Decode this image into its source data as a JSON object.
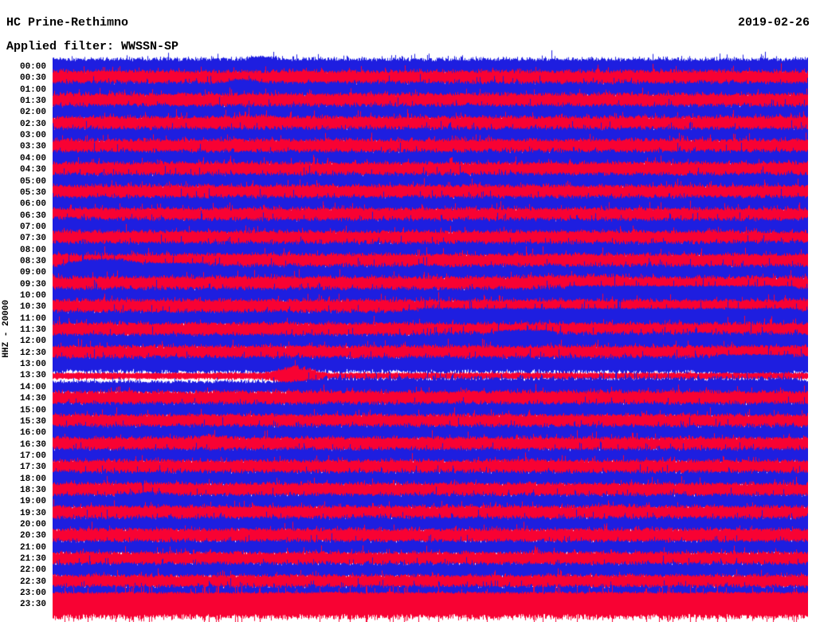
{
  "header": {
    "station_title": "HC Prine-Rethimno",
    "filter_label": "Applied filter: WWSSN-SP",
    "date": "2019-02-26"
  },
  "y_axis": {
    "scale_label": "HHZ - 20000"
  },
  "colors": {
    "red": "#f80233",
    "blue": "#1e1ee0",
    "text": "#000000",
    "background": "#ffffff"
  },
  "chart_data": {
    "type": "helicorder",
    "title": "HC Prine-Rethimno",
    "subtitle": "Applied filter: WWSSN-SP",
    "date": "2019-02-26",
    "channel_scale": "HHZ - 20000",
    "row_interval_minutes": 30,
    "rows_start": "00:00",
    "rows_end": "23:30",
    "legend": "alternating red/blue half-hour traces",
    "rows": [
      {
        "time": "00:00",
        "color": "blue",
        "amp": 11,
        "events": [
          [
            0.26,
            0.29,
            15
          ]
        ]
      },
      {
        "time": "00:30",
        "color": "red",
        "amp": 10,
        "events": []
      },
      {
        "time": "01:00",
        "color": "blue",
        "amp": 10.5,
        "events": [
          [
            0.23,
            0.27,
            14
          ]
        ]
      },
      {
        "time": "01:30",
        "color": "red",
        "amp": 10,
        "events": []
      },
      {
        "time": "02:00",
        "color": "blue",
        "amp": 10.5,
        "events": []
      },
      {
        "time": "02:30",
        "color": "red",
        "amp": 10,
        "events": [
          [
            0.24,
            0.28,
            12
          ]
        ]
      },
      {
        "time": "03:00",
        "color": "blue",
        "amp": 10.5,
        "events": []
      },
      {
        "time": "03:30",
        "color": "red",
        "amp": 10,
        "events": []
      },
      {
        "time": "04:00",
        "color": "blue",
        "amp": 10.5,
        "events": []
      },
      {
        "time": "04:30",
        "color": "red",
        "amp": 10,
        "events": []
      },
      {
        "time": "05:00",
        "color": "blue",
        "amp": 10.5,
        "events": []
      },
      {
        "time": "05:30",
        "color": "red",
        "amp": 10,
        "events": []
      },
      {
        "time": "06:00",
        "color": "blue",
        "amp": 10.5,
        "events": []
      },
      {
        "time": "06:30",
        "color": "red",
        "amp": 10,
        "events": []
      },
      {
        "time": "07:00",
        "color": "blue",
        "amp": 11,
        "events": [
          [
            0.0,
            0.05,
            13
          ]
        ]
      },
      {
        "time": "07:30",
        "color": "red",
        "amp": 10,
        "events": []
      },
      {
        "time": "08:00",
        "color": "blue",
        "amp": 10.5,
        "events": [
          [
            0.9,
            1.0,
            12
          ]
        ]
      },
      {
        "time": "08:30",
        "color": "red",
        "amp": 10,
        "events": []
      },
      {
        "time": "09:00",
        "color": "blue",
        "amp": 10.5,
        "events": [
          [
            0.025,
            0.11,
            18
          ],
          [
            0.11,
            0.22,
            13
          ]
        ]
      },
      {
        "time": "09:30",
        "color": "red",
        "amp": 10,
        "events": [
          [
            0.62,
            0.75,
            12
          ]
        ]
      },
      {
        "time": "10:00",
        "color": "blue",
        "amp": 10.5,
        "events": [
          [
            0.66,
            1.0,
            13
          ]
        ]
      },
      {
        "time": "10:30",
        "color": "red",
        "amp": 10,
        "events": []
      },
      {
        "time": "11:00",
        "color": "blue",
        "amp": 10.5,
        "events": [
          [
            0.47,
            1.0,
            13.5
          ]
        ]
      },
      {
        "time": "11:30",
        "color": "red",
        "amp": 9.5,
        "events": []
      },
      {
        "time": "12:00",
        "color": "blue",
        "amp": 10,
        "events": [
          [
            0.5,
            1.0,
            12
          ],
          [
            0.58,
            0.67,
            15
          ]
        ]
      },
      {
        "time": "12:30",
        "color": "red",
        "amp": 9.5,
        "events": []
      },
      {
        "time": "13:00",
        "color": "blue",
        "amp": 10.5,
        "events": [
          [
            0.86,
            1.0,
            13
          ]
        ]
      },
      {
        "time": "13:30",
        "color": "red",
        "amp": 4,
        "events": [
          [
            0.3,
            0.342,
            13
          ]
        ]
      },
      {
        "time": "14:00",
        "color": "blue",
        "amp": 8,
        "events": [
          [
            0.342,
            1.0,
            12.5
          ]
        ]
      },
      {
        "time": "14:30",
        "color": "red",
        "amp": 10,
        "events": []
      },
      {
        "time": "15:00",
        "color": "blue",
        "amp": 10,
        "events": []
      },
      {
        "time": "15:30",
        "color": "red",
        "amp": 9.5,
        "events": []
      },
      {
        "time": "16:00",
        "color": "blue",
        "amp": 10.5,
        "events": []
      },
      {
        "time": "16:30",
        "color": "red",
        "amp": 9.5,
        "events": [
          [
            0.19,
            0.23,
            12
          ]
        ]
      },
      {
        "time": "17:00",
        "color": "blue",
        "amp": 10,
        "events": []
      },
      {
        "time": "17:30",
        "color": "red",
        "amp": 9.5,
        "events": [
          [
            0.6,
            0.64,
            12
          ]
        ]
      },
      {
        "time": "18:00",
        "color": "blue",
        "amp": 10,
        "events": []
      },
      {
        "time": "18:30",
        "color": "red",
        "amp": 9.5,
        "events": []
      },
      {
        "time": "19:00",
        "color": "blue",
        "amp": 10,
        "events": [
          [
            0.1,
            0.15,
            13
          ]
        ]
      },
      {
        "time": "19:30",
        "color": "red",
        "amp": 9.5,
        "events": [
          [
            0.72,
            0.76,
            12
          ]
        ]
      },
      {
        "time": "20:00",
        "color": "blue",
        "amp": 10,
        "events": [
          [
            0.4,
            0.44,
            12
          ]
        ]
      },
      {
        "time": "20:30",
        "color": "red",
        "amp": 9.5,
        "events": []
      },
      {
        "time": "21:00",
        "color": "blue",
        "amp": 9.5,
        "events": []
      },
      {
        "time": "21:30",
        "color": "red",
        "amp": 9,
        "events": []
      },
      {
        "time": "22:00",
        "color": "blue",
        "amp": 10,
        "events": []
      },
      {
        "time": "22:30",
        "color": "red",
        "amp": 9,
        "events": []
      },
      {
        "time": "23:00",
        "color": "blue",
        "amp": 10,
        "events": []
      },
      {
        "time": "23:30",
        "color": "red",
        "amp": 16,
        "events": []
      }
    ]
  }
}
